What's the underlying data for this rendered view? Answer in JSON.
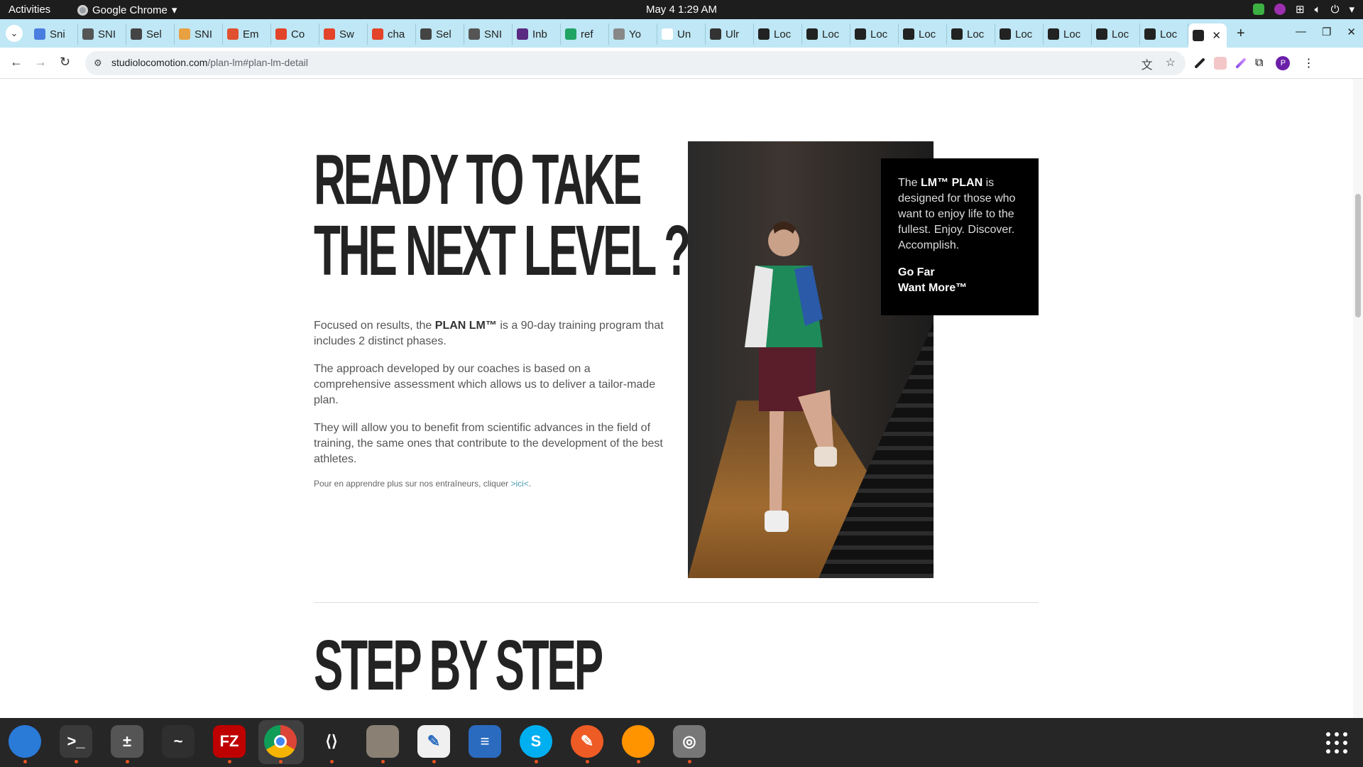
{
  "topbar": {
    "activities": "Activities",
    "app_name": "Google Chrome",
    "clock": "May 4  1:29 AM"
  },
  "tabs": [
    {
      "label": "Sni",
      "color": "#4a7de0"
    },
    {
      "label": "SNI",
      "color": "#555555"
    },
    {
      "label": "Sel",
      "color": "#444444"
    },
    {
      "label": "SNI",
      "color": "#e8a040"
    },
    {
      "label": "Em",
      "color": "#e05030"
    },
    {
      "label": "Co",
      "color": "#e24329"
    },
    {
      "label": "Sw",
      "color": "#e24329"
    },
    {
      "label": "cha",
      "color": "#e24329"
    },
    {
      "label": "Sel",
      "color": "#444444"
    },
    {
      "label": "SNI",
      "color": "#555555"
    },
    {
      "label": "Inb",
      "color": "#5a2a82"
    },
    {
      "label": "ref",
      "color": "#1fa463"
    },
    {
      "label": "Yo",
      "color": "#888888"
    },
    {
      "label": "Un",
      "color": "#ffffff"
    },
    {
      "label": "Ulr",
      "color": "#333333"
    },
    {
      "label": "Loc",
      "color": "#222222"
    },
    {
      "label": "Loc",
      "color": "#222222"
    },
    {
      "label": "Loc",
      "color": "#222222"
    },
    {
      "label": "Loc",
      "color": "#222222"
    },
    {
      "label": "Loc",
      "color": "#222222"
    },
    {
      "label": "Loc",
      "color": "#222222"
    },
    {
      "label": "Loc",
      "color": "#222222"
    },
    {
      "label": "Loc",
      "color": "#222222"
    },
    {
      "label": "Loc",
      "color": "#222222"
    }
  ],
  "address_bar": {
    "domain": "studiolocomotion.com",
    "path": "/plan-lm#plan-lm-detail"
  },
  "profile_initial": "P",
  "hero": {
    "title_line1": "READY TO TAKE",
    "title_line2": "THE NEXT LEVEL  ?",
    "p1_pre": "Focused on results, the ",
    "p1_bold": "PLAN LM™",
    "p1_post": " is a 90-day training program that includes 2 distinct phases.",
    "p2": "The approach developed by our coaches is based on a comprehensive assessment which allows us to deliver a tailor-made plan.",
    "p3": "They will allow you to benefit from scientific advances in the field of training, the same ones that contribute to the development of the best athletes.",
    "link_pre": "Pour en apprendre plus sur nos entraîneurs, cliquer ",
    "link_text": ">ici<",
    "link_post": "."
  },
  "infobox": {
    "pre": "The ",
    "bold": "LM™ PLAN",
    "post": " is designed for those who want to enjoy life to the fullest. Enjoy. Discover. Accomplish.",
    "tag1": "Go Far",
    "tag2": "Want More™"
  },
  "step": {
    "title": "STEP BY STEP"
  },
  "dock": [
    {
      "name": "thunderbird-icon",
      "color": "#2a7ad8",
      "glyph": ""
    },
    {
      "name": "terminal-icon",
      "color": "#3a3a3a",
      "glyph": ">_"
    },
    {
      "name": "calculator-icon",
      "color": "#555555",
      "glyph": "±"
    },
    {
      "name": "system-monitor-icon",
      "color": "#2f2f2f",
      "glyph": "~"
    },
    {
      "name": "filezilla-icon",
      "color": "#bf0000",
      "glyph": "FZ"
    },
    {
      "name": "chrome-icon",
      "color": "#ffffff",
      "glyph": ""
    },
    {
      "name": "vscode-icon",
      "color": "#262626",
      "glyph": "⟨⟩"
    },
    {
      "name": "files-icon",
      "color": "#8a8074",
      "glyph": ""
    },
    {
      "name": "text-editor-icon",
      "color": "#f0f0f0",
      "glyph": "✎"
    },
    {
      "name": "libreoffice-writer-icon",
      "color": "#2a6bbf",
      "glyph": "≡"
    },
    {
      "name": "skype-icon",
      "color": "#00aff0",
      "glyph": "S"
    },
    {
      "name": "postman-icon",
      "color": "#ef5b25",
      "glyph": "✎"
    },
    {
      "name": "firefox-icon",
      "color": "#ff9400",
      "glyph": ""
    },
    {
      "name": "disks-icon",
      "color": "#777777",
      "glyph": "◎"
    }
  ]
}
